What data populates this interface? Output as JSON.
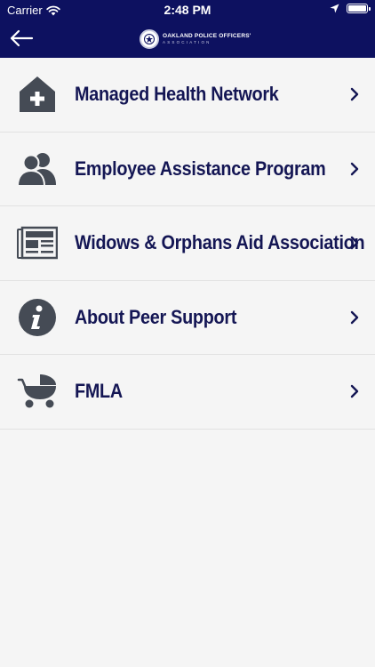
{
  "status_bar": {
    "carrier": "Carrier",
    "time": "2:48 PM"
  },
  "header": {
    "logo_line1": "OAKLAND POLICE OFFICERS'",
    "logo_line2": "ASSOCIATION",
    "back_icon": "arrow-left-icon"
  },
  "colors": {
    "header_bg": "#0d1160",
    "text": "#141654",
    "icon": "#454b55",
    "background": "#f5f5f5"
  },
  "menu": {
    "items": [
      {
        "label": "Managed Health Network",
        "icon": "health-house-icon"
      },
      {
        "label": "Employee Assistance Program",
        "icon": "users-icon"
      },
      {
        "label": "Widows & Orphans Aid Association",
        "icon": "newspaper-icon"
      },
      {
        "label": "About Peer Support",
        "icon": "info-icon"
      },
      {
        "label": "FMLA",
        "icon": "baby-carriage-icon"
      }
    ]
  }
}
